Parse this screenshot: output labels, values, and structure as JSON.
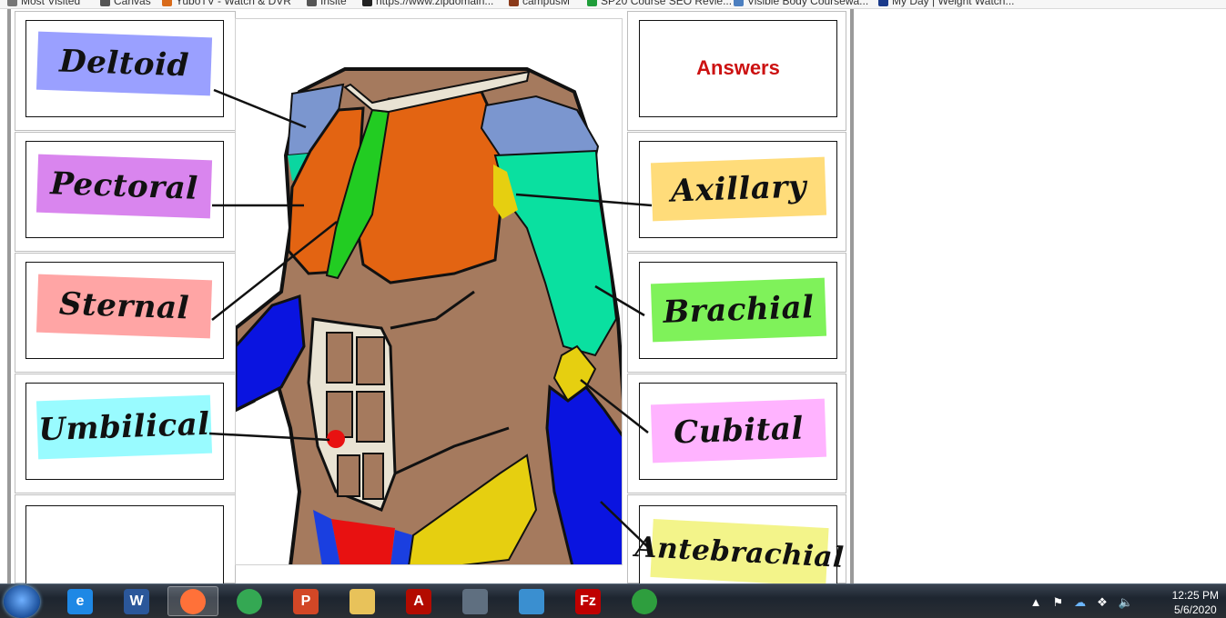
{
  "bookmarks": [
    {
      "label": "Most Visited",
      "color": "#777777"
    },
    {
      "label": "Canvas",
      "color": "#555555"
    },
    {
      "label": "YuboTV - Watch & DVR",
      "color": "#d96b1a"
    },
    {
      "label": "Insite",
      "color": "#555555"
    },
    {
      "label": "https://www.zipdomain...",
      "color": "#222222"
    },
    {
      "label": "campusM",
      "color": "#8a3a1a"
    },
    {
      "label": "SP20 Course SEO Revie...",
      "color": "#1f9d3a"
    },
    {
      "label": "Visible Body Coursewa...",
      "color": "#4c7fc0"
    },
    {
      "label": "My Day | Weight Watch...",
      "color": "#1a3a8a"
    }
  ],
  "left_labels": [
    {
      "text": "Deltoid",
      "bg": "#9aa0ff"
    },
    {
      "text": "Pectoral",
      "bg": "#d985ee"
    },
    {
      "text": "Sternal",
      "bg": "#ffa5a5"
    },
    {
      "text": "Umbilical",
      "bg": "#99fbff"
    },
    {
      "text": "",
      "bg": "#ffffff"
    }
  ],
  "right_header": "Answers",
  "right_labels": [
    {
      "text": "Axillary",
      "bg": "#ffdc7a"
    },
    {
      "text": "Brachial",
      "bg": "#7ff25a"
    },
    {
      "text": "Cubital",
      "bg": "#ffb3ff"
    },
    {
      "text": "Antebrachial",
      "bg": "#f3f48a"
    }
  ],
  "taskbar": {
    "apps": [
      {
        "name": "ie-icon",
        "glyph": "e",
        "color": "#1e88e5",
        "active": false
      },
      {
        "name": "word-icon",
        "glyph": "W",
        "color": "#2b579a",
        "active": false
      },
      {
        "name": "firefox-icon",
        "glyph": "",
        "color": "#ff7139",
        "active": true
      },
      {
        "name": "chrome-icon",
        "glyph": "",
        "color": "#34a853",
        "active": false
      },
      {
        "name": "powerpoint-icon",
        "glyph": "P",
        "color": "#d24726",
        "active": false
      },
      {
        "name": "file-explorer-icon",
        "glyph": "",
        "color": "#e8c25a",
        "active": false
      },
      {
        "name": "acrobat-icon",
        "glyph": "A",
        "color": "#b30b00",
        "active": false
      },
      {
        "name": "camera-icon",
        "glyph": "",
        "color": "#5f6f80",
        "active": false
      },
      {
        "name": "photo-viewer-icon",
        "glyph": "",
        "color": "#3a8fd0",
        "active": false
      },
      {
        "name": "filezilla-icon",
        "glyph": "Fz",
        "color": "#bf0000",
        "active": false
      },
      {
        "name": "vpn-icon",
        "glyph": "",
        "color": "#2e9e3e",
        "active": false
      }
    ],
    "time": "12:25 PM",
    "date": "5/6/2020"
  }
}
